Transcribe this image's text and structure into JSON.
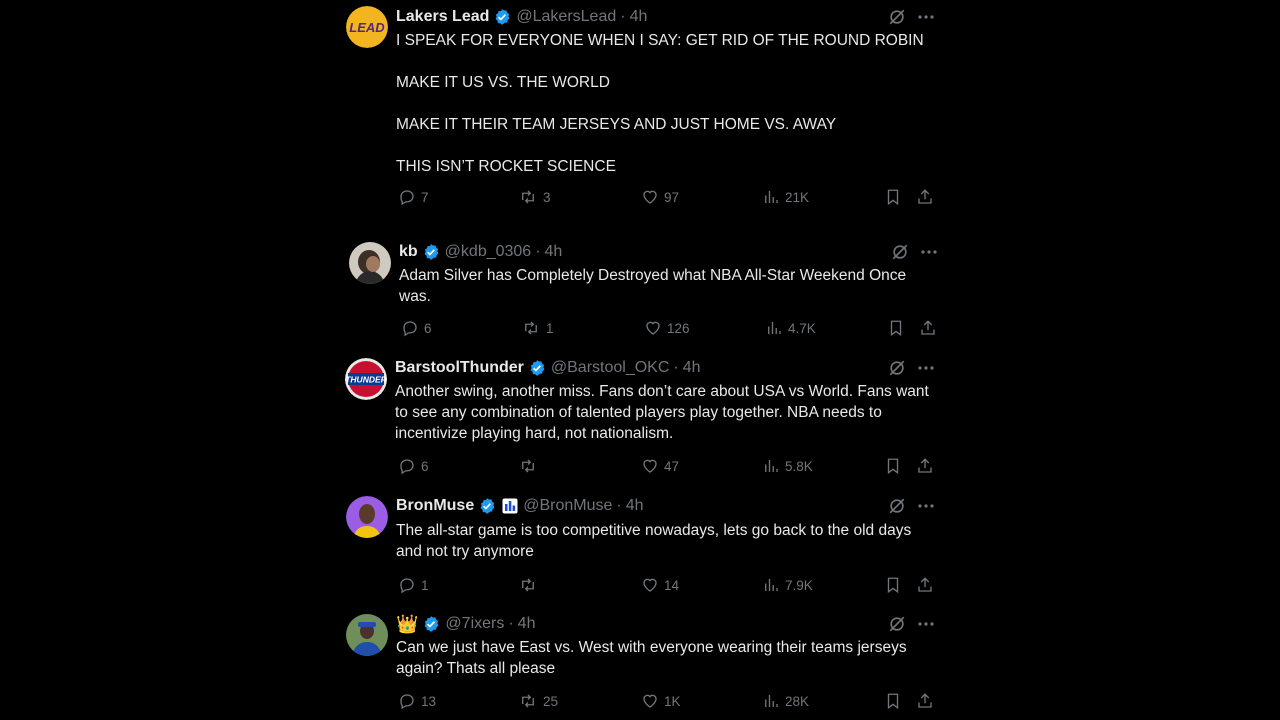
{
  "tweets": [
    {
      "name": "Lakers Lead",
      "handle": "@LakersLead",
      "time": "4h",
      "avatar": "lakers-lead-logo",
      "avatar_text": "LEAD",
      "text": "I SPEAK FOR EVERYONE WHEN I SAY: GET RID OF THE ROUND ROBIN\n\nMAKE IT US VS. THE WORLD\n\nMAKE IT THEIR TEAM JERSEYS AND JUST HOME VS. AWAY\n\nTHIS ISN’T ROCKET SCIENCE",
      "replies": "7",
      "reposts": "3",
      "likes": "97",
      "views": "21K"
    },
    {
      "name": "kb",
      "handle": "@kdb_0306",
      "time": "4h",
      "avatar": "profile-photo",
      "text": "Adam Silver has Completely Destroyed what NBA All-Star Weekend Once was.",
      "replies": "6",
      "reposts": "1",
      "likes": "126",
      "views": "4.7K"
    },
    {
      "name": "BarstoolThunder",
      "handle": "@Barstool_OKC",
      "time": "4h",
      "avatar": "thunder-logo",
      "avatar_text": "THUNDER",
      "text": "Another swing, another miss. Fans don’t care about USA vs World. Fans want to see any combination of talented players play together. NBA needs to incentivize playing hard, not nationalism.",
      "replies": "6",
      "reposts": "",
      "likes": "47",
      "views": "5.8K"
    },
    {
      "name": "BronMuse",
      "handle": "@BronMuse",
      "time": "4h",
      "avatar": "profile-photo",
      "text": "The all-star game is too competitive nowadays, lets go back to the old days and not try anymore",
      "replies": "1",
      "reposts": "",
      "likes": "14",
      "views": "7.9K"
    },
    {
      "name": "👑",
      "handle": "@7ixers",
      "time": "4h",
      "avatar": "profile-photo",
      "text": "Can we just have East vs. West with everyone wearing their teams jerseys again? Thats all please",
      "replies": "13",
      "reposts": "25",
      "likes": "1K",
      "views": "28K"
    }
  ],
  "separator": "·",
  "icons": [
    "verified-badge-icon",
    "grok-icon",
    "more-icon",
    "reply-icon",
    "repost-icon",
    "like-icon",
    "views-icon",
    "bookmark-icon",
    "share-icon"
  ],
  "colors": {
    "background": "#000000",
    "text": "#e7e9ea",
    "muted": "#71767b",
    "verified": "#1d9bf0"
  }
}
